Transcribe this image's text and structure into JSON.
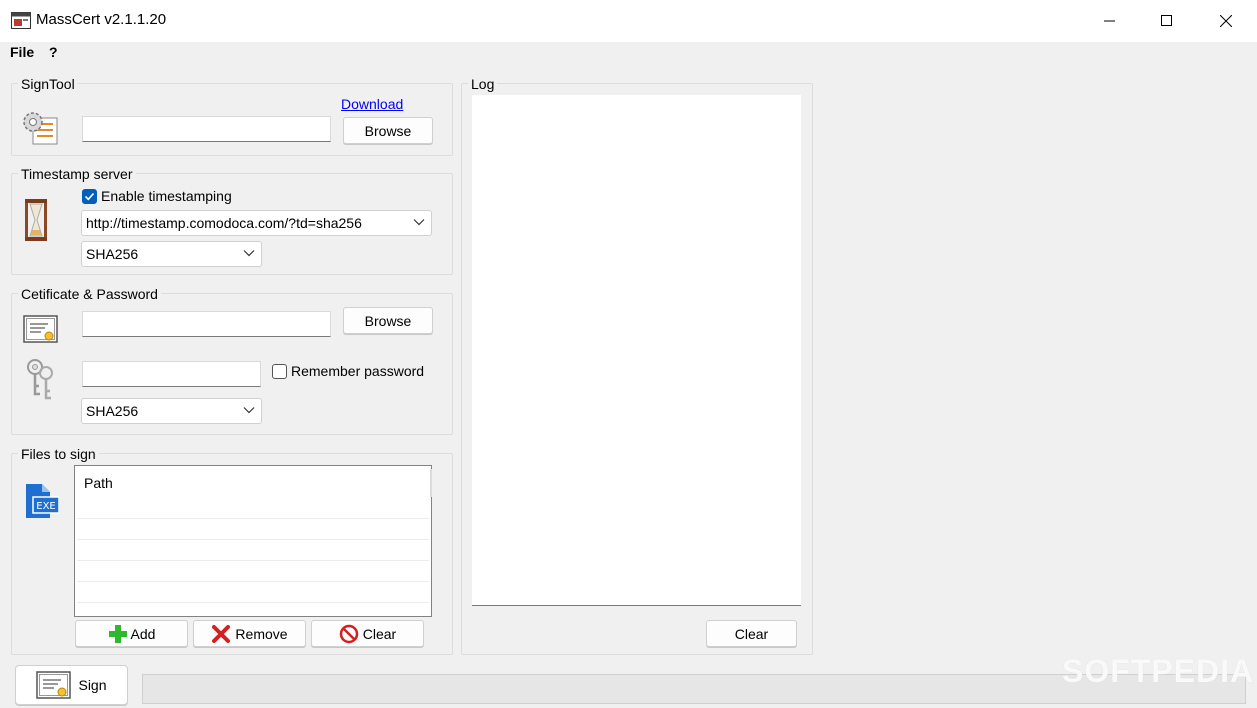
{
  "window": {
    "title": "MassCert v2.1.1.20",
    "controls": [
      "minimize-icon",
      "maximize-icon",
      "close-icon"
    ]
  },
  "menu": {
    "items": [
      "File",
      "?"
    ]
  },
  "signtool": {
    "group_label": "SignTool",
    "download_link": "Download",
    "path_value": "",
    "browse_label": "Browse",
    "icon": "gear-document-icon"
  },
  "timestamp": {
    "group_label": "Timestamp server",
    "enable_label": "Enable timestamping",
    "enable_checked": true,
    "server_value": "http://timestamp.comodoca.com/?td=sha256",
    "algorithm_value": "SHA256",
    "icon": "hourglass-icon"
  },
  "certificate": {
    "group_label": "Cetificate & Password",
    "path_value": "",
    "browse_label": "Browse",
    "password_value": "",
    "remember_label": "Remember password",
    "remember_checked": false,
    "algorithm_value": "SHA256",
    "icons": [
      "certificate-icon",
      "keys-icon"
    ]
  },
  "files": {
    "group_label": "Files to sign",
    "column_header": "Path",
    "rows": [],
    "add_label": "Add",
    "remove_label": "Remove",
    "clear_label": "Clear",
    "icon": "exe-file-icon"
  },
  "log": {
    "group_label": "Log",
    "content": "",
    "clear_label": "Clear"
  },
  "footer": {
    "sign_label": "Sign",
    "status_text": ""
  },
  "watermark": "SOFTPEDIA",
  "colors": {
    "accent": "#005fb8",
    "link": "#0000ff",
    "background": "#f0f0f0"
  }
}
